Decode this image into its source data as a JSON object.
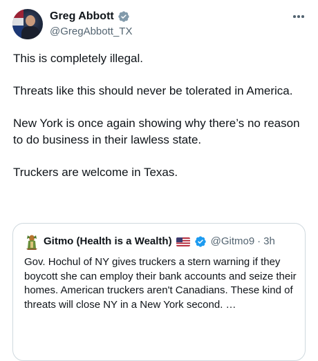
{
  "tweet": {
    "author": {
      "display_name": "Greg Abbott",
      "handle": "@GregAbbott_TX",
      "avatar_icon": "avatar-photo",
      "verified_icon": "verified-badge-gray",
      "verified_color": "#829aab"
    },
    "more_icon": "more-options-icon",
    "paragraphs": [
      "This is completely illegal.",
      "Threats like this should never be tolerated in America.",
      "New York is once again showing why there’s no reason to do business in their lawless state.",
      "Truckers are welcome in Texas."
    ]
  },
  "quoted_tweet": {
    "display_name": "Gitmo (Health is a Wealth)",
    "flag_icon": "us-flag-emoji",
    "verified_icon": "verified-badge-blue",
    "verified_color": "#1d9bf0",
    "handle": "@Gitmo9",
    "separator": "·",
    "time": "3h",
    "text": "Gov. Hochul of NY gives truckers a stern warning if they boycott she can employ their bank accounts and seize their homes. American truckers aren't Canadians. These kind of threats will close NY in a New York second. …"
  },
  "colors": {
    "text_primary": "#0f1419",
    "text_secondary": "#536471",
    "border": "#cfd9de"
  }
}
